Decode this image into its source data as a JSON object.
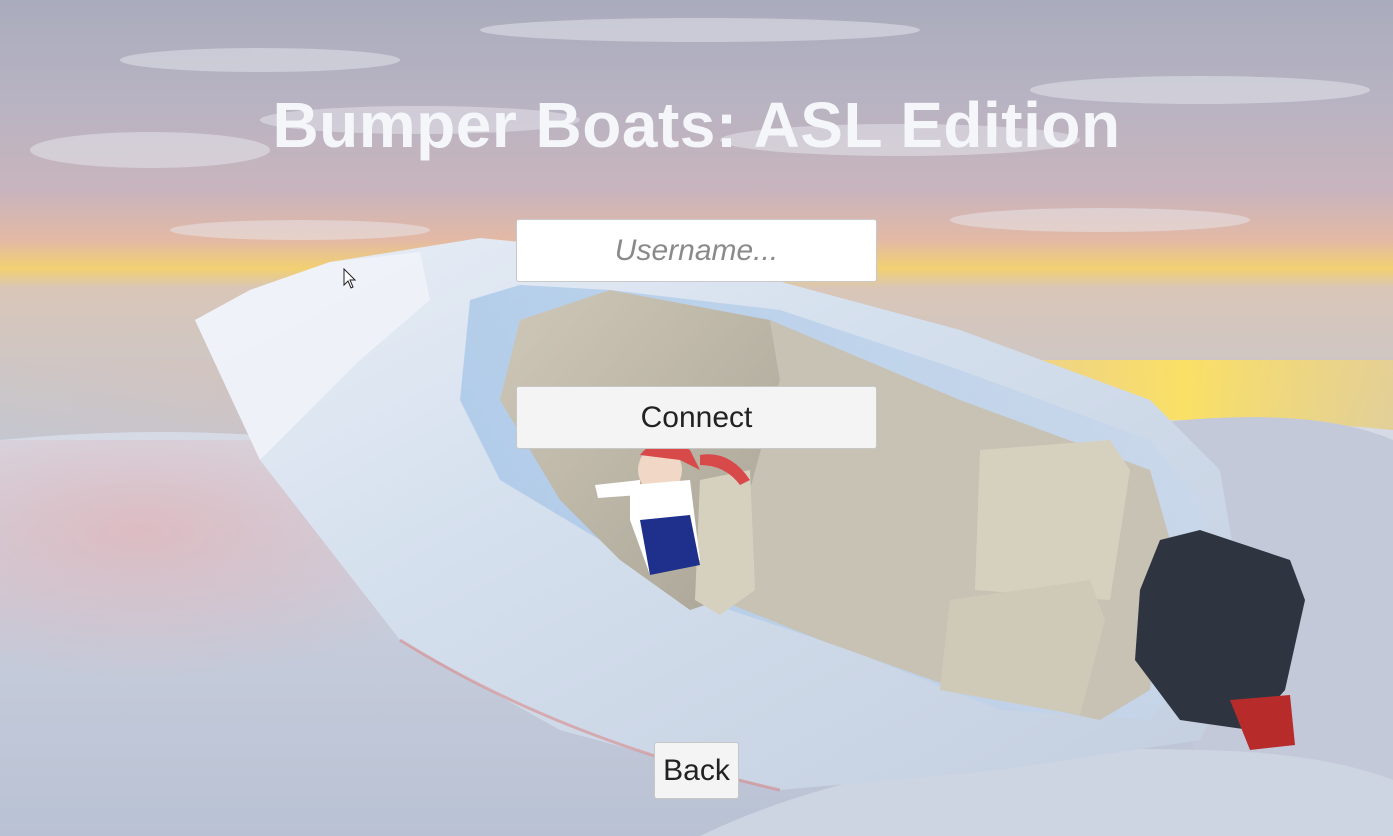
{
  "title": "Bumper Boats: ASL Edition",
  "username": {
    "value": "",
    "placeholder": "Username..."
  },
  "buttons": {
    "connect": "Connect",
    "back": "Back"
  },
  "icons": {
    "cursor": "mouse-pointer-icon"
  },
  "colors": {
    "title": "#f4f6fa",
    "button_bg": "#f4f4f4",
    "input_bg": "#ffffff",
    "placeholder": "#8a8a8a"
  }
}
